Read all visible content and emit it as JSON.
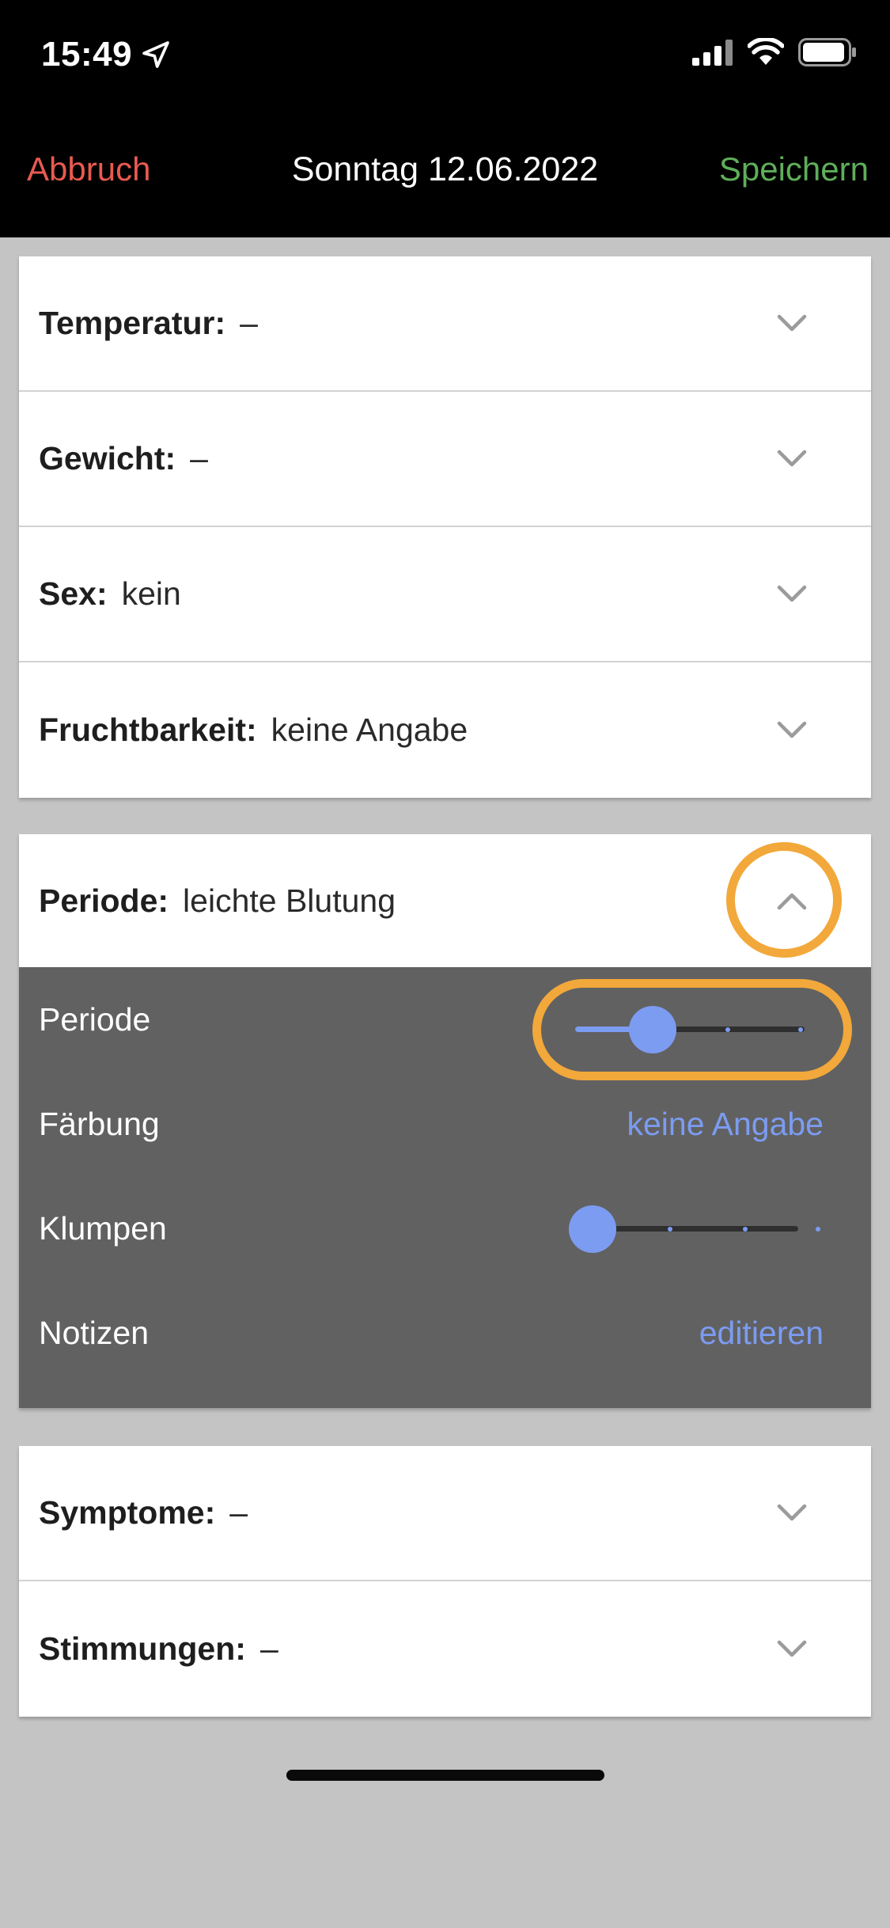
{
  "status": {
    "time": "15:49"
  },
  "nav": {
    "cancel": "Abbruch",
    "title": "Sonntag 12.06.2022",
    "save": "Speichern"
  },
  "card1": [
    {
      "label": "Temperatur:",
      "value": "–"
    },
    {
      "label": "Gewicht:",
      "value": "–"
    },
    {
      "label": "Sex:",
      "value": "kein"
    },
    {
      "label": "Fruchtbarkeit:",
      "value": "keine Angabe"
    }
  ],
  "periode": {
    "label": "Periode:",
    "value": "leichte Blutung",
    "periode_label": "Periode",
    "periode_level": 1,
    "periode_max": 3,
    "faerbung_label": "Färbung",
    "faerbung_value": "keine Angabe",
    "klumpen_label": "Klumpen",
    "klumpen_level": 0,
    "notizen_label": "Notizen",
    "notizen_link": "editieren"
  },
  "card3": [
    {
      "label": "Symptome:",
      "value": "–"
    },
    {
      "label": "Stimmungen:",
      "value": "–"
    }
  ],
  "colors": {
    "accent": "#7c9cf2",
    "cancel": "#e85a50",
    "save": "#5fae5a",
    "highlight": "#f2a83a"
  }
}
